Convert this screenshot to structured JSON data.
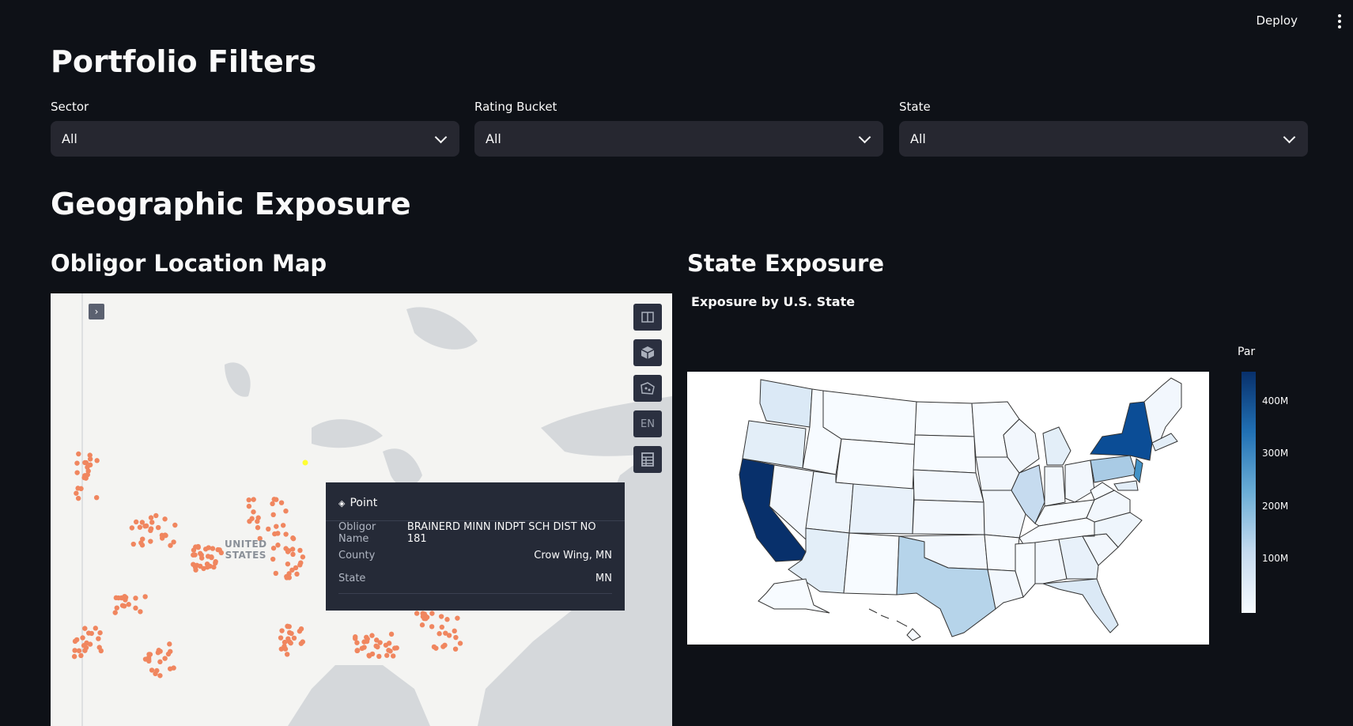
{
  "header": {
    "deploy_label": "Deploy",
    "menu_icon": "kebab-icon"
  },
  "filters": {
    "title": "Portfolio Filters",
    "sector": {
      "label": "Sector",
      "value": "All"
    },
    "rating": {
      "label": "Rating Bucket",
      "value": "All"
    },
    "state": {
      "label": "State",
      "value": "All"
    }
  },
  "geo": {
    "title": "Geographic Exposure",
    "map_title": "Obligor Location Map",
    "state_title": "State Exposure"
  },
  "map": {
    "country_label_1": "UNITED",
    "country_label_2": "STATES",
    "controls": [
      "book-icon",
      "cube-icon",
      "polygon-icon",
      "EN",
      "table-icon"
    ],
    "lang_label": "EN",
    "point_color": "#f0865f",
    "highlight_color": "#ffff33",
    "tooltip": {
      "title": "Point",
      "rows": [
        {
          "key": "Obligor Name",
          "value": "BRAINERD MINN INDPT SCH DIST NO 181"
        },
        {
          "key": "County",
          "value": "Crow Wing, MN"
        },
        {
          "key": "State",
          "value": "MN"
        }
      ]
    }
  },
  "chart_data": {
    "type": "choropleth",
    "title": "Exposure by U.S. State",
    "legend_title": "Par",
    "colorbar_ticks": [
      "400M",
      "300M",
      "200M",
      "100M"
    ],
    "colorscale": [
      "#f7fbff",
      "#c6dbef",
      "#6baed6",
      "#2171b5",
      "#08306b"
    ]
  }
}
